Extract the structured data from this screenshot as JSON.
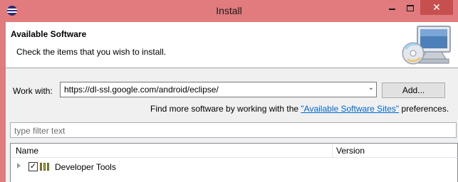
{
  "window": {
    "title": "Install",
    "title_bar_color": "#e17b7e",
    "close_color": "#c7504f"
  },
  "header": {
    "title": "Available Software",
    "description": "Check the items that you wish to install.",
    "image_icon": "computer-cd-icon"
  },
  "work_with": {
    "label": "Work with:",
    "value": "https://dl-ssl.google.com/android/eclipse/",
    "add_button": "Add..."
  },
  "find_more": {
    "prefix": "Find more software by working with the ",
    "link": "\"Available Software Sites\"",
    "suffix": " preferences."
  },
  "filter": {
    "placeholder": "type filter text"
  },
  "tree": {
    "columns": [
      "Name",
      "Version"
    ],
    "rows": [
      {
        "label": "Developer Tools",
        "version": "",
        "checked": true,
        "expanded": false,
        "icon": "feature-group-icon"
      }
    ]
  },
  "colors": {
    "link": "#0066cc",
    "header_bg": "#ffffff",
    "dialog_bg": "#f0f0f0"
  }
}
